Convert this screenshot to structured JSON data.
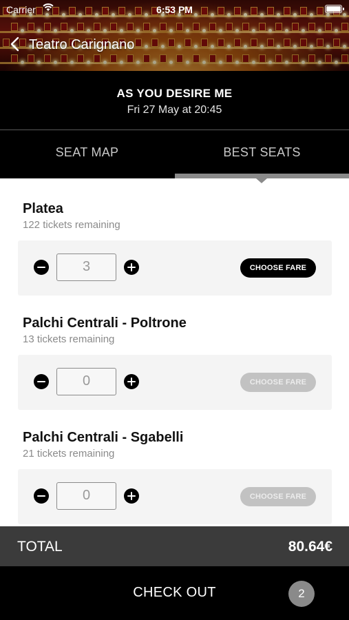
{
  "status_bar": {
    "carrier": "Carrier",
    "time": "6:53 PM"
  },
  "nav": {
    "title": "Teatro Carignano"
  },
  "event": {
    "name": "AS YOU DESIRE ME",
    "date": "Fri 27 May at 20:45"
  },
  "tabs": [
    {
      "label": "SEAT MAP",
      "selected": false
    },
    {
      "label": "BEST SEATS",
      "selected": true
    }
  ],
  "sections": [
    {
      "name": "Platea",
      "remaining": "122 tickets remaining",
      "quantity": "3",
      "fare_label": "CHOOSE FARE",
      "fare_enabled": true
    },
    {
      "name": "Palchi Centrali - Poltrone",
      "remaining": "13 tickets remaining",
      "quantity": "0",
      "fare_label": "CHOOSE FARE",
      "fare_enabled": false
    },
    {
      "name": "Palchi Centrali - Sgabelli",
      "remaining": "21 tickets remaining",
      "quantity": "0",
      "fare_label": "CHOOSE FARE",
      "fare_enabled": false
    }
  ],
  "total": {
    "label": "TOTAL",
    "amount": "80.64€"
  },
  "checkout": {
    "label": "CHECK OUT",
    "count": "2"
  },
  "icons": {
    "back": "chevron-left-icon",
    "wifi": "wifi-icon",
    "battery": "battery-icon",
    "minus": "minus-circle-icon",
    "plus": "plus-circle-icon"
  },
  "colors": {
    "header_bg": "#000000",
    "total_bg": "#3b3b3b",
    "badge_bg": "#8a8a8a",
    "fare_active": "#000000",
    "fare_disabled": "#c2c2c2"
  }
}
